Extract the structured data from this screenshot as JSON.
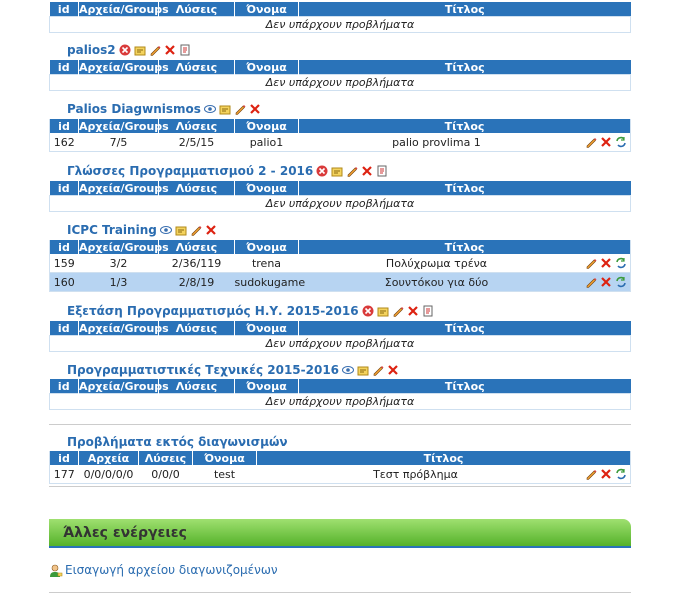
{
  "columns": {
    "id": "id",
    "groups": "Αρχεία/Groups",
    "solutions": "Λύσεις",
    "name": "Όνομα",
    "title": "Τίτλος"
  },
  "columns_alt": {
    "id": "id",
    "files": "Αρχεία",
    "solutions": "Λύσεις",
    "name": "Όνομα",
    "title": "Τίτλος"
  },
  "empty_msg": "Δεν υπάρχουν προβλήματα",
  "contests": [
    {
      "title": "palios2"
    },
    {
      "title": "Palios Diagwnismos",
      "rows": [
        {
          "id": "162",
          "groups": "7/5",
          "solutions": "2/5/15",
          "name": "palio1",
          "title": "palio provlima 1"
        }
      ]
    },
    {
      "title": "Γλώσσες Προγραμματισμού 2 - 2016"
    },
    {
      "title": "ICPC Training",
      "rows": [
        {
          "id": "159",
          "groups": "3/2",
          "solutions": "2/36/119",
          "name": "trena",
          "title": "Πολύχρωμα τρένα"
        },
        {
          "id": "160",
          "groups": "1/3",
          "solutions": "2/8/19",
          "name": "sudokugame",
          "title": "Σουντόκου για δύο"
        }
      ]
    },
    {
      "title": "Εξετάση Προγραμματισμός Η.Υ. 2015-2016"
    },
    {
      "title": "Προγραμματιστικές Τεχνικές 2015-2016"
    }
  ],
  "outside": {
    "title": "Προβλήματα εκτός διαγωνισμών",
    "rows": [
      {
        "id": "177",
        "files": "0/0/0/0/0",
        "solutions": "0/0/0",
        "name": "test",
        "title": "Τεστ πρόβλημα"
      }
    ]
  },
  "other_actions": {
    "title": "Άλλες ενέργειες",
    "import_link": "Εισαγωγή αρχείου διαγωνιζομένων"
  },
  "colors": {
    "header_blue": "#2a73b9",
    "title_blue": "#2a6cb0",
    "highlight_row": "#b7d4f2",
    "green_bar": "#55b22a"
  }
}
